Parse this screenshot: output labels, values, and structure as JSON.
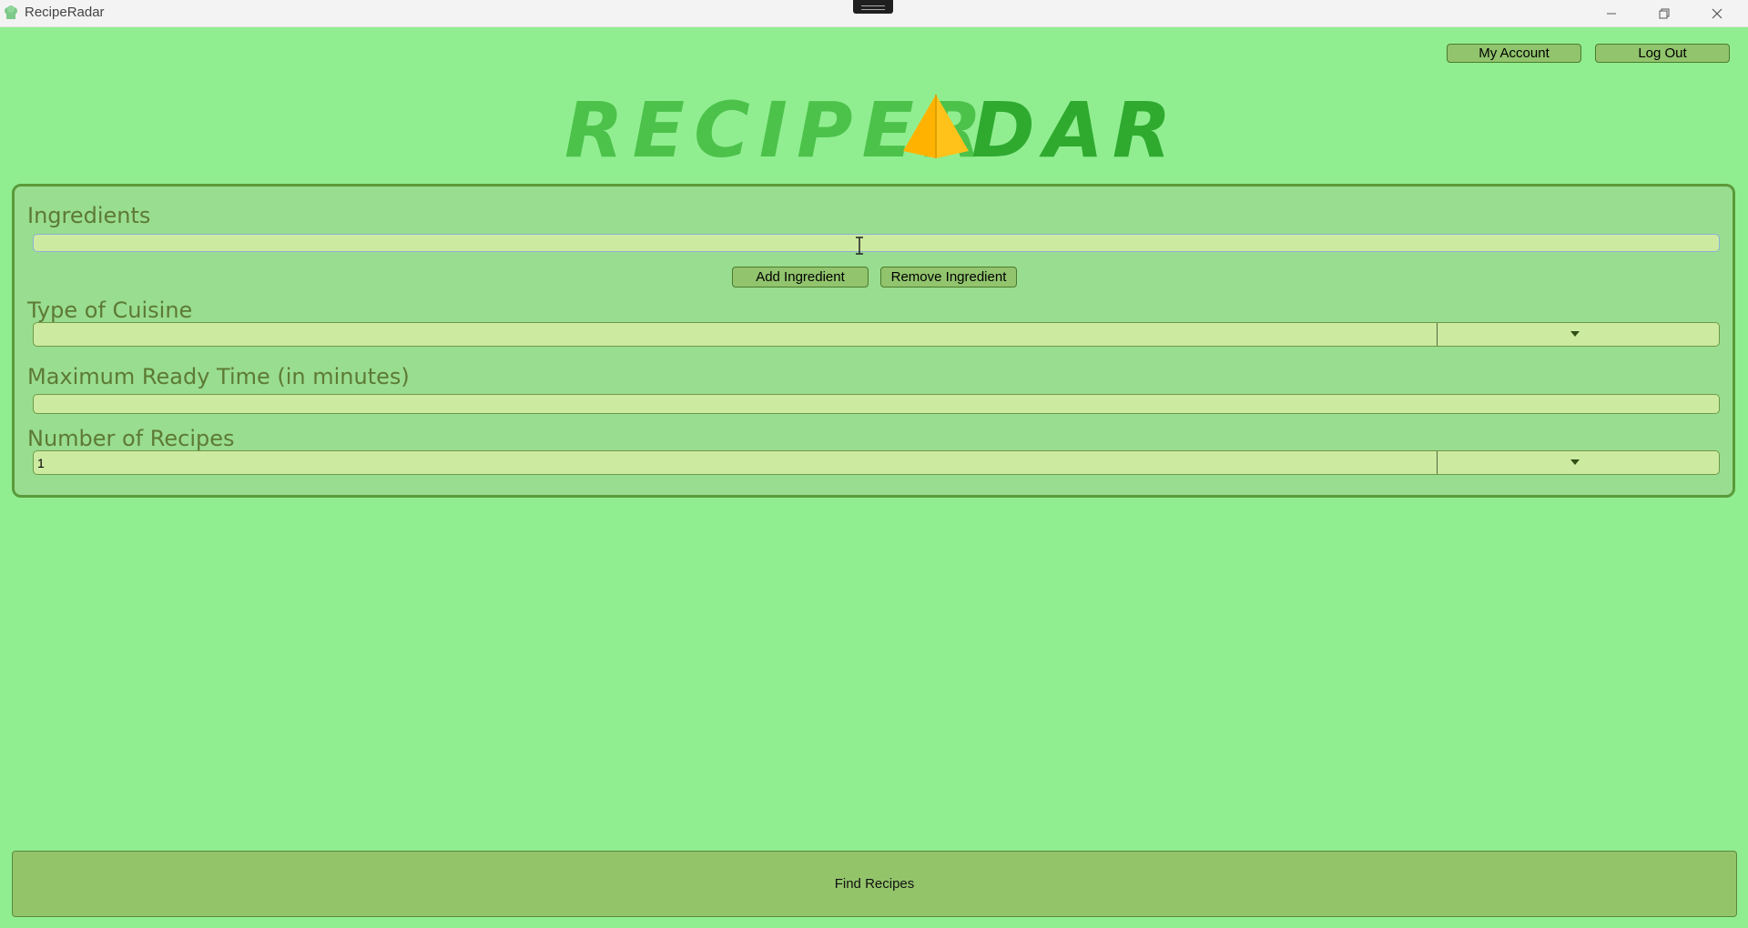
{
  "window": {
    "title": "RecipeRadar",
    "app_icon": "chef-hat-icon",
    "controls": [
      "minimize-icon",
      "restore-icon",
      "close-icon"
    ]
  },
  "header": {
    "my_account_label": "My Account",
    "log_out_label": "Log Out",
    "logo": {
      "text_left": "RECIPER",
      "text_right": "DAR",
      "emblem": "radar-pyramid-icon"
    }
  },
  "form": {
    "ingredients": {
      "label": "Ingredients",
      "value": "",
      "add_label": "Add Ingredient",
      "remove_label": "Remove Ingredient"
    },
    "cuisine": {
      "label": "Type of Cuisine",
      "value": ""
    },
    "ready_time": {
      "label": "Maximum Ready Time (in minutes)",
      "value": ""
    },
    "num_recipes": {
      "label": "Number of Recipes",
      "value": "1"
    }
  },
  "actions": {
    "find_label": "Find Recipes"
  },
  "colors": {
    "background": "#90ee90",
    "panel": "#99dd90",
    "field": "#cdeba0",
    "button": "#91c46d",
    "logo_green": "#4cc24a",
    "logo_dark_green": "#2faa2f",
    "emblem_yellow": "#ffba00"
  }
}
